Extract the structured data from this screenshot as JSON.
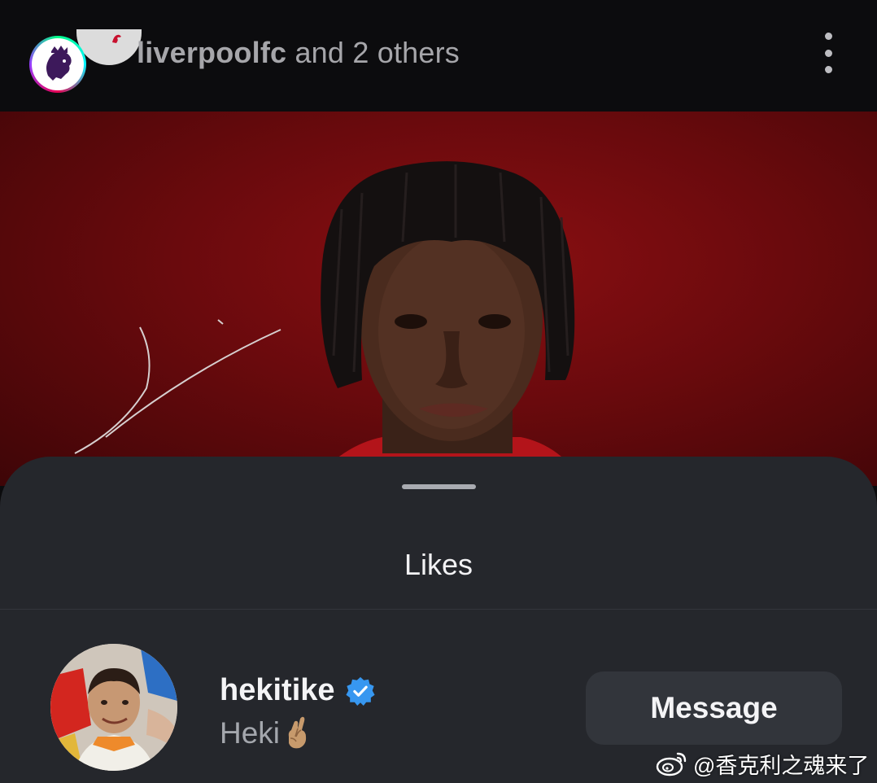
{
  "header": {
    "account": "liverpoolfc",
    "connector": " and 2 others",
    "menu_icon": "more-vertical-icon"
  },
  "sheet": {
    "title": "Likes"
  },
  "user": {
    "username": "hekitike",
    "verified_icon": "verified-badge-icon",
    "display_name": "Heki",
    "display_emoji": "crossed-fingers-emoji",
    "message_label": "Message"
  },
  "watermark": {
    "text": "@香克利之魂来了",
    "logo_icon": "weibo-icon"
  },
  "colors": {
    "header_bg": "#0c0c0e",
    "sheet_bg": "#25272c",
    "button_bg": "#32353b",
    "verified_blue": "#3797f0",
    "photo_red": "#7a0c0f"
  }
}
